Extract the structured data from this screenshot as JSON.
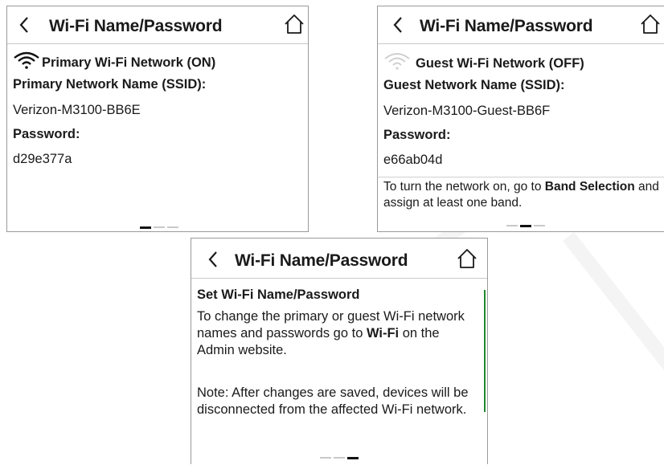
{
  "screen1": {
    "back_icon": "chevron-left-icon",
    "title": "Wi-Fi Name/Password",
    "home_icon": "home-icon",
    "network_label": "Primary Wi-Fi Network (ON)",
    "wifi_icon_state": "active",
    "ssid_label": "Primary Network Name (SSID):",
    "ssid_value": "Verizon-M3100-BB6E",
    "password_label": "Password:",
    "password_value": "d29e377a",
    "page_indicator": {
      "pages": 3,
      "current": 1
    }
  },
  "screen2": {
    "back_icon": "chevron-left-icon",
    "title": "Wi-Fi Name/Password",
    "home_icon": "home-icon",
    "network_label": "Guest Wi-Fi Network (OFF)",
    "wifi_icon_state": "inactive",
    "ssid_label": "Guest Network Name (SSID):",
    "ssid_value": "Verizon-M3100-Guest-BB6F",
    "password_label": "Password:",
    "password_value": "e66ab04d",
    "note_part1": "To turn the network on, go to ",
    "note_bold1": "Band Selection",
    "note_part2": " and assign at least one band.",
    "page_indicator": {
      "pages": 3,
      "current": 2
    }
  },
  "screen3": {
    "back_icon": "chevron-left-icon",
    "title": "Wi-Fi Name/Password",
    "home_icon": "home-icon",
    "heading": "Set Wi-Fi Name/Password",
    "para1_part1": "To change the primary or guest Wi-Fi network names and passwords go to ",
    "para1_bold": "Wi-Fi",
    "para1_part2": " on the Admin website.",
    "para2": "Note: After changes are saved, devices will be disconnected from the affected Wi-Fi network.",
    "page_indicator": {
      "pages": 3,
      "current": 3
    }
  },
  "colors": {
    "scrollbar": "#1f8a2e",
    "wifi_active": "#111111",
    "wifi_inactive": "#cfcfcf"
  }
}
